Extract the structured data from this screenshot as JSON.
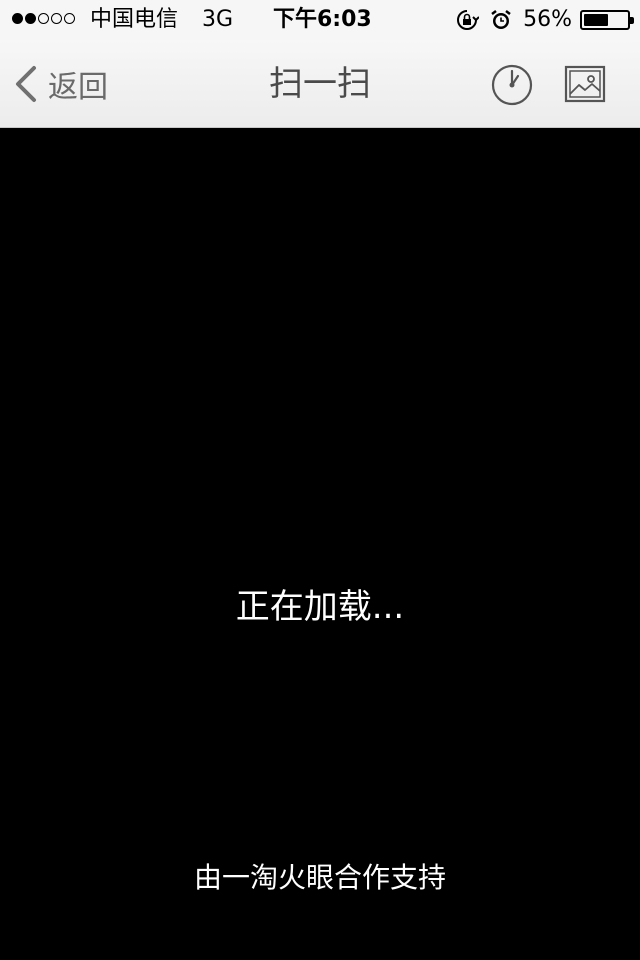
{
  "status_bar": {
    "signal_strength": "2/5",
    "carrier": "中国电信",
    "network": "3G",
    "time": "下午6:03",
    "battery_percent": "56%",
    "battery_level": 0.56,
    "icons": [
      "rotation-lock-icon",
      "alarm-icon",
      "battery-icon"
    ]
  },
  "nav": {
    "back_label": "返回",
    "title": "扫一扫",
    "right_icons": [
      "history-clock-icon",
      "photo-album-icon"
    ]
  },
  "main": {
    "loading_text": "正在加载...",
    "powered_by": "由一淘火眼合作支持"
  }
}
